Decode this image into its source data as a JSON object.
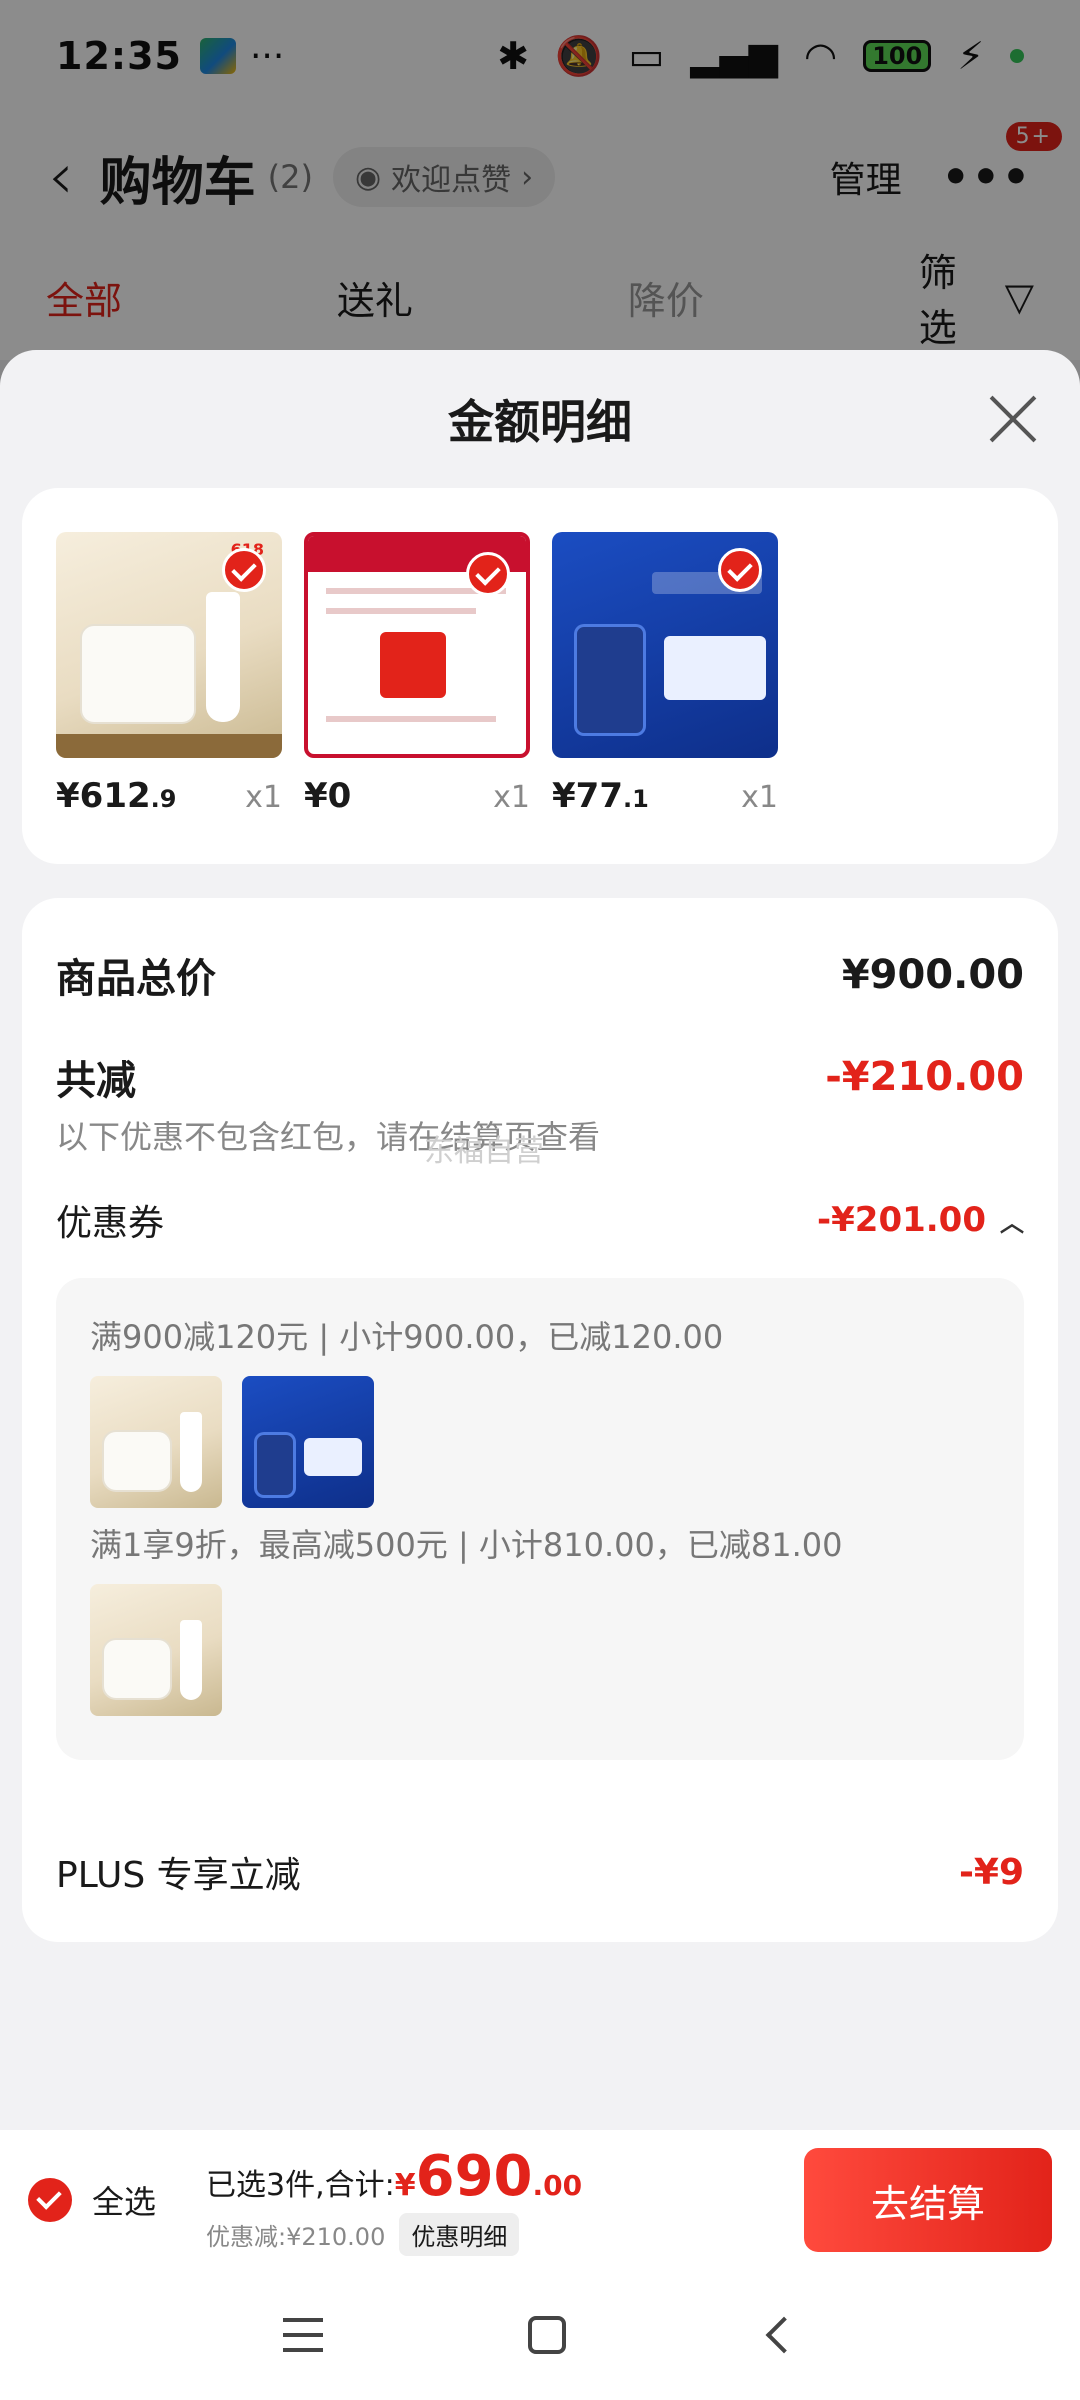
{
  "status_bar": {
    "time": "12:35",
    "dots": "···",
    "battery": "100"
  },
  "header": {
    "back_icon": "‹",
    "title": "购物车",
    "count": "(2)",
    "like_text": "欢迎点赞",
    "like_chevron": "›",
    "manage": "管理",
    "more_icon": "•••",
    "badge": "5+"
  },
  "tabs": [
    "全部",
    "送礼",
    "降价"
  ],
  "filter_label": "筛选",
  "sheet": {
    "title": "金额明细"
  },
  "products": [
    {
      "price_main": "¥612",
      "price_decimal": ".9",
      "qty": "x1",
      "icon": "eve-lom-cleansing-balm"
    },
    {
      "price_main": "¥0",
      "price_decimal": "",
      "qty": "x1",
      "icon": "winona-trial-coupon"
    },
    {
      "price_main": "¥77",
      "price_decimal": ".1",
      "qty": "x1",
      "icon": "takami-serum"
    }
  ],
  "detail": {
    "total_label": "商品总价",
    "total_value": "¥900.00",
    "reduce_label": "共减",
    "reduce_value": "-¥210.00",
    "note": "以下优惠不包含红包，请在结算页查看",
    "coupon_label": "优惠券",
    "coupon_value": "-¥201.00",
    "coupon_caret": "︿",
    "coupon_rule_1": "满900减120元 | 小计900.00，已减120.00",
    "coupon_rule_2": "满1享9折，最高减500元 | 小计810.00，已减81.00",
    "plus_label": "PLUS 专享立减",
    "plus_value": "-¥9"
  },
  "watermark": "东福自营",
  "bottom_bar": {
    "select_all": "全选",
    "selected_text": "已选3件,合计:",
    "total_yen": "¥",
    "total_int": "690",
    "total_dec": ".00",
    "discount_text": "优惠减:¥210.00",
    "detail_button": "优惠明细",
    "checkout": "去结算"
  },
  "colors": {
    "accent": "#e2231a",
    "checkout_gradient_start": "#ff4a3d"
  }
}
